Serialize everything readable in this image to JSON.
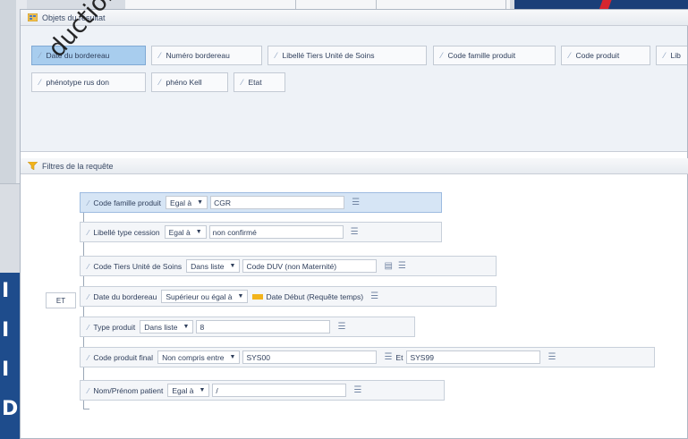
{
  "objects_section": {
    "title": "Objets du résultat"
  },
  "result_objects": [
    {
      "label": "Date du bordereau",
      "selected": true
    },
    {
      "label": "Numéro bordereau"
    },
    {
      "label": "Libellé Tiers Unité de Soins"
    },
    {
      "label": "Code famille produit"
    },
    {
      "label": "Code produit"
    },
    {
      "label": "Lib"
    },
    {
      "label": "phénotype rus don"
    },
    {
      "label": "phéno Kell"
    },
    {
      "label": "Etat"
    }
  ],
  "filters_section": {
    "title": "Filtres de la requête"
  },
  "logic_operator": "ET",
  "filters": [
    {
      "field": "Code famille produit",
      "operator": "Egal à",
      "value": "CGR"
    },
    {
      "field": "Libellé type cession",
      "operator": "Egal à",
      "value": "non confirmé"
    },
    {
      "field": "Code Tiers Unité de Soins",
      "operator": "Dans liste",
      "value": "Code DUV (non Maternité)"
    },
    {
      "field": "Date du bordereau",
      "operator": "Supérieur ou égal à",
      "value": "Date Début (Requête temps)"
    },
    {
      "field": "Type produit",
      "operator": "Dans liste",
      "value": "8"
    },
    {
      "field": "Code produit final",
      "operator": "Non compris entre",
      "value": "SYS00",
      "between_label": "Et",
      "value2": "SYS99"
    },
    {
      "field": "Nom/Prénom patient",
      "operator": "Egal à",
      "value": "/"
    }
  ],
  "watermark": "duction mê",
  "background": {
    "left_text": [
      "I",
      "I",
      "I",
      "D"
    ]
  },
  "colors": {
    "selected_chip": "#a8cdee",
    "prompt": "#f2b31b",
    "brand_blue": "#1b3f78",
    "brand_red": "#d6262f"
  }
}
